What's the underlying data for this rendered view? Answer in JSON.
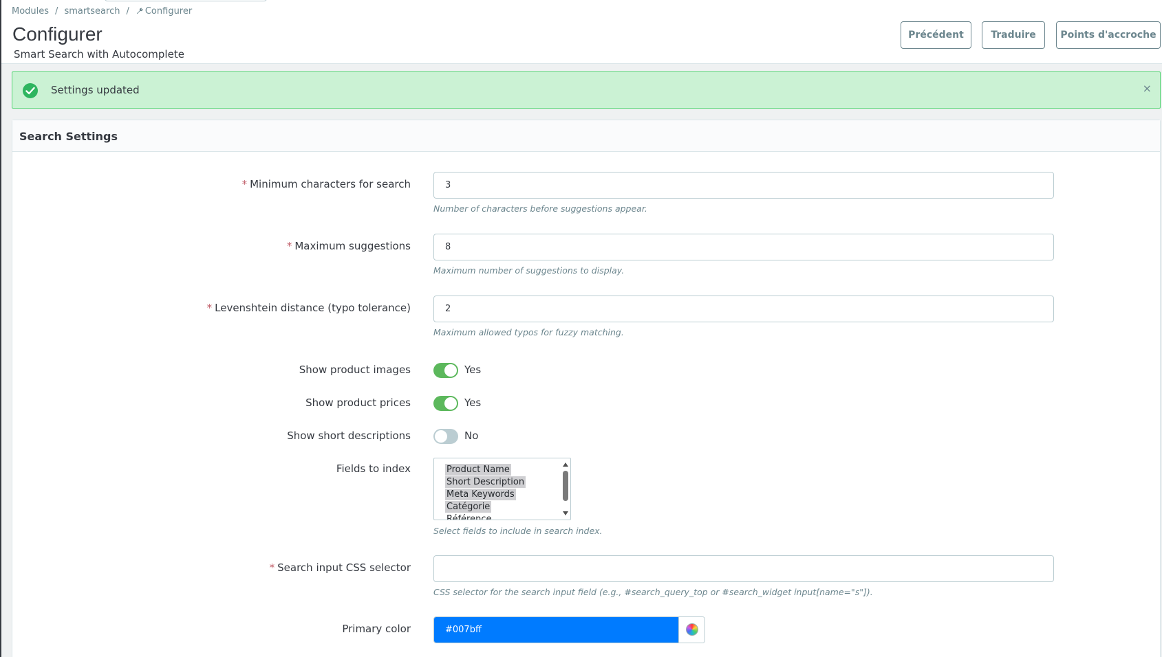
{
  "breadcrumb": {
    "items": [
      "Modules",
      "smartsearch",
      "Configurer"
    ],
    "separator": "/",
    "current_icon": "wrench-icon"
  },
  "header": {
    "title": "Configurer",
    "subtitle": "Smart Search with Autocomplete"
  },
  "toolbar": {
    "back_label": "Précédent",
    "translate_label": "Traduire",
    "hooks_label": "Points d'accroche"
  },
  "alert": {
    "message": "Settings updated",
    "close_symbol": "×",
    "icon": "check-circle-icon",
    "color": "#cbf2d4"
  },
  "panel": {
    "title": "Search Settings"
  },
  "form": {
    "required_mark": "*",
    "min_chars": {
      "label": "Minimum characters for search",
      "value": "3",
      "help": "Number of characters before suggestions appear."
    },
    "max_suggestions": {
      "label": "Maximum suggestions",
      "value": "8",
      "help": "Maximum number of suggestions to display."
    },
    "levenshtein": {
      "label": "Levenshtein distance (typo tolerance)",
      "value": "2",
      "help": "Maximum allowed typos for fuzzy matching."
    },
    "show_images": {
      "label": "Show product images",
      "state": "Yes",
      "on": true
    },
    "show_prices": {
      "label": "Show product prices",
      "state": "Yes",
      "on": true
    },
    "show_short_desc": {
      "label": "Show short descriptions",
      "state": "No",
      "on": false
    },
    "fields_to_index": {
      "label": "Fields to index",
      "options": [
        {
          "text": "Product Name",
          "selected": true
        },
        {
          "text": "Short Description",
          "selected": true
        },
        {
          "text": "Meta Keywords",
          "selected": true
        },
        {
          "text": "Catégorie",
          "selected": true
        },
        {
          "text": "Référence",
          "selected": false
        }
      ],
      "help": "Select fields to include in search index."
    },
    "css_selector": {
      "label": "Search input CSS selector",
      "value": "",
      "help": "CSS selector for the search input field (e.g., #search_query_top or #search_widget input[name=\"s\"])."
    },
    "primary_color": {
      "label": "Primary color",
      "value": "#007bff",
      "picker_icon": "color-wheel-icon"
    }
  },
  "colors": {
    "switch_on": "#5cb85c",
    "switch_off": "#bbcdd2",
    "required": "#c05c67",
    "success_border": "#53d572"
  }
}
